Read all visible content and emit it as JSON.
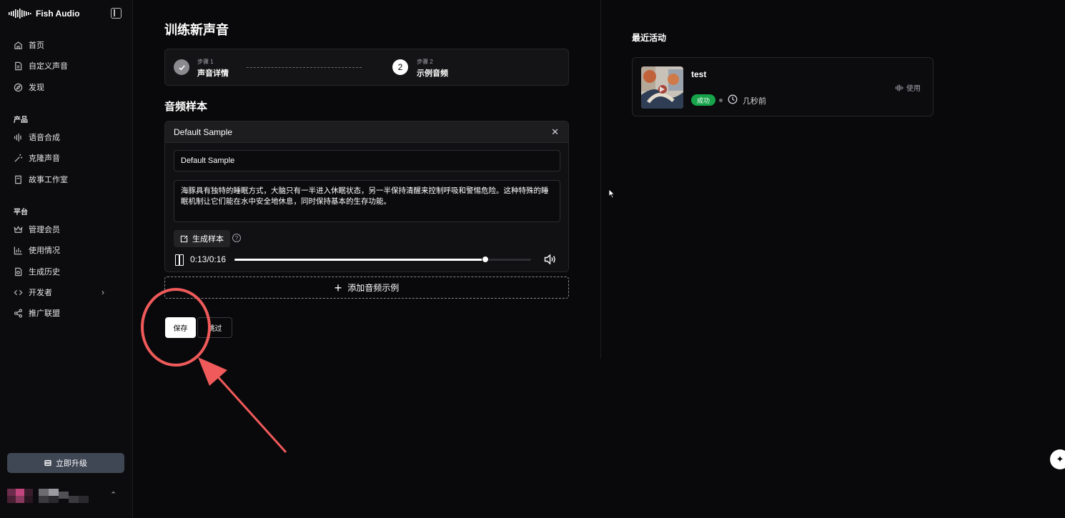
{
  "app": {
    "brand": "Fish Audio"
  },
  "sidebar": {
    "items": [
      {
        "label": "首页",
        "icon": "home-icon"
      },
      {
        "label": "自定义声音",
        "icon": "file-icon"
      },
      {
        "label": "发现",
        "icon": "compass-icon"
      }
    ],
    "section_product": "产品",
    "product_items": [
      {
        "label": "语音合成",
        "icon": "waveform-icon"
      },
      {
        "label": "克隆声音",
        "icon": "magic-wand-icon"
      },
      {
        "label": "故事工作室",
        "icon": "book-icon"
      }
    ],
    "section_platform": "平台",
    "platform_items": [
      {
        "label": "管理会员",
        "icon": "crown-icon"
      },
      {
        "label": "使用情况",
        "icon": "bar-chart-icon"
      },
      {
        "label": "生成历史",
        "icon": "history-icon"
      },
      {
        "label": "开发者",
        "icon": "code-icon"
      },
      {
        "label": "推广联盟",
        "icon": "share-icon"
      }
    ],
    "upgrade_label": "立即升级"
  },
  "main": {
    "title": "训练新声音",
    "steps": [
      {
        "small": "步骤 1",
        "label": "声音详情",
        "state": "done"
      },
      {
        "number": "2",
        "small": "步骤 2",
        "label": "示例音频",
        "state": "current"
      }
    ],
    "section_title": "音频样本",
    "sample": {
      "header": "Default Sample",
      "name_value": "Default Sample",
      "text_value": "海豚具有独特的睡眠方式，大脑只有一半进入休眠状态，另一半保持清醒来控制呼吸和警惕危险。这种特殊的睡眠机制让它们能在水中安全地休息，同时保持基本的生存功能。",
      "generate_label": "生成样本",
      "help_symbol": "?",
      "time": "0:13/0:16",
      "progress": 0.845
    },
    "add_sample_label": "添加音频示例",
    "save_label": "保存",
    "skip_label": "跳过"
  },
  "recent": {
    "title": "最近活动",
    "items": [
      {
        "name": "test",
        "status": "成功",
        "time_ago": "几秒前",
        "use_label": "使用"
      }
    ]
  },
  "colors": {
    "background": "#09090b",
    "success": "#16a34a",
    "annotation": "#f05a5a",
    "upgrade": "#3f4654"
  }
}
